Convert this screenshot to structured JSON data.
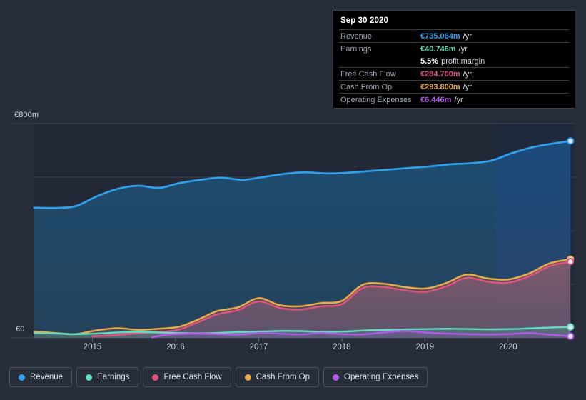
{
  "chart_data": {
    "type": "area",
    "title": "",
    "xlabel": "",
    "ylabel": "",
    "currency": "EUR",
    "y_axis": {
      "ticks": [
        "€800m",
        "€0"
      ],
      "max_label": "€800m",
      "min_label": "€0",
      "ylim": [
        0,
        800
      ],
      "gridlines": [
        0,
        200,
        400,
        600,
        800
      ],
      "grid": true
    },
    "x_axis": {
      "tick_labels": [
        "2015",
        "2016",
        "2017",
        "2018",
        "2019",
        "2020"
      ],
      "tick_values": [
        2015,
        2016,
        2017,
        2018,
        2019,
        2020
      ]
    },
    "legend_position": "bottom",
    "highlight_band_start": "2019.8",
    "series": [
      {
        "name": "Revenue",
        "color": "#2e9fe8",
        "values": [
          [
            2014.3,
            486
          ],
          [
            2014.55,
            485
          ],
          [
            2014.8,
            492
          ],
          [
            2015.05,
            528
          ],
          [
            2015.3,
            556
          ],
          [
            2015.55,
            568
          ],
          [
            2015.8,
            560
          ],
          [
            2016.05,
            578
          ],
          [
            2016.3,
            590
          ],
          [
            2016.55,
            598
          ],
          [
            2016.8,
            590
          ],
          [
            2017.05,
            600
          ],
          [
            2017.3,
            612
          ],
          [
            2017.55,
            618
          ],
          [
            2017.8,
            614
          ],
          [
            2018.05,
            616
          ],
          [
            2018.3,
            622
          ],
          [
            2018.55,
            628
          ],
          [
            2018.8,
            634
          ],
          [
            2019.05,
            640
          ],
          [
            2019.3,
            648
          ],
          [
            2019.55,
            652
          ],
          [
            2019.8,
            662
          ],
          [
            2020.05,
            690
          ],
          [
            2020.3,
            712
          ],
          [
            2020.55,
            726
          ],
          [
            2020.75,
            735.064
          ]
        ]
      },
      {
        "name": "Earnings",
        "color": "#63dbc0",
        "values": [
          [
            2014.3,
            18
          ],
          [
            2014.55,
            16
          ],
          [
            2014.8,
            14
          ],
          [
            2015.05,
            16
          ],
          [
            2015.3,
            20
          ],
          [
            2015.55,
            22
          ],
          [
            2015.8,
            20
          ],
          [
            2016.05,
            18
          ],
          [
            2016.3,
            17
          ],
          [
            2016.55,
            19
          ],
          [
            2016.8,
            22
          ],
          [
            2017.05,
            24
          ],
          [
            2017.3,
            26
          ],
          [
            2017.55,
            25
          ],
          [
            2017.8,
            22
          ],
          [
            2018.05,
            24
          ],
          [
            2018.3,
            28
          ],
          [
            2018.55,
            30
          ],
          [
            2018.8,
            32
          ],
          [
            2019.05,
            33
          ],
          [
            2019.3,
            34
          ],
          [
            2019.55,
            33
          ],
          [
            2019.8,
            32
          ],
          [
            2020.05,
            33
          ],
          [
            2020.3,
            36
          ],
          [
            2020.55,
            39
          ],
          [
            2020.75,
            40.746
          ]
        ]
      },
      {
        "name": "Free Cash Flow",
        "color": "#e0517e",
        "values": [
          [
            2015.0,
            6
          ],
          [
            2015.25,
            10
          ],
          [
            2015.5,
            16
          ],
          [
            2015.75,
            22
          ],
          [
            2016.0,
            28
          ],
          [
            2016.25,
            56
          ],
          [
            2016.5,
            88
          ],
          [
            2016.75,
            104
          ],
          [
            2017.0,
            136
          ],
          [
            2017.25,
            112
          ],
          [
            2017.5,
            106
          ],
          [
            2017.75,
            118
          ],
          [
            2018.0,
            126
          ],
          [
            2018.25,
            186
          ],
          [
            2018.5,
            190
          ],
          [
            2018.75,
            178
          ],
          [
            2019.0,
            172
          ],
          [
            2019.25,
            192
          ],
          [
            2019.5,
            224
          ],
          [
            2019.75,
            210
          ],
          [
            2020.0,
            206
          ],
          [
            2020.25,
            230
          ],
          [
            2020.5,
            268
          ],
          [
            2020.75,
            284.7
          ]
        ]
      },
      {
        "name": "Cash From Op",
        "color": "#eaa94b",
        "values": [
          [
            2014.3,
            24
          ],
          [
            2014.55,
            18
          ],
          [
            2014.8,
            14
          ],
          [
            2015.05,
            28
          ],
          [
            2015.3,
            36
          ],
          [
            2015.55,
            30
          ],
          [
            2015.8,
            34
          ],
          [
            2016.05,
            42
          ],
          [
            2016.3,
            72
          ],
          [
            2016.5,
            100
          ],
          [
            2016.75,
            114
          ],
          [
            2017.0,
            148
          ],
          [
            2017.25,
            122
          ],
          [
            2017.5,
            118
          ],
          [
            2017.75,
            130
          ],
          [
            2018.0,
            138
          ],
          [
            2018.25,
            198
          ],
          [
            2018.5,
            202
          ],
          [
            2018.75,
            190
          ],
          [
            2019.0,
            184
          ],
          [
            2019.25,
            204
          ],
          [
            2019.5,
            236
          ],
          [
            2019.75,
            222
          ],
          [
            2020.0,
            218
          ],
          [
            2020.25,
            240
          ],
          [
            2020.5,
            278
          ],
          [
            2020.75,
            293.8
          ]
        ]
      },
      {
        "name": "Operating Expenses",
        "color": "#b45ae8",
        "values": [
          [
            2015.72,
            2
          ],
          [
            2015.85,
            10
          ],
          [
            2016.0,
            14
          ],
          [
            2016.25,
            16
          ],
          [
            2016.5,
            14
          ],
          [
            2016.75,
            12
          ],
          [
            2017.0,
            18
          ],
          [
            2017.25,
            16
          ],
          [
            2017.5,
            13
          ],
          [
            2017.75,
            18
          ],
          [
            2018.0,
            14
          ],
          [
            2018.25,
            13
          ],
          [
            2018.5,
            20
          ],
          [
            2018.75,
            26
          ],
          [
            2019.0,
            20
          ],
          [
            2019.25,
            16
          ],
          [
            2019.5,
            14
          ],
          [
            2019.75,
            13
          ],
          [
            2020.0,
            14
          ],
          [
            2020.25,
            18
          ],
          [
            2020.5,
            12
          ],
          [
            2020.75,
            6.446
          ]
        ]
      }
    ],
    "endpoints": [
      {
        "series": "Revenue",
        "value": 735.064
      },
      {
        "series": "Cash From Op",
        "value": 293.8
      },
      {
        "series": "Free Cash Flow",
        "value": 284.7
      },
      {
        "series": "Earnings",
        "value": 40.746
      },
      {
        "series": "Operating Expenses",
        "value": 6.446
      }
    ]
  },
  "tooltip": {
    "date": "Sep 30 2020",
    "rows": [
      {
        "label": "Revenue",
        "value": "€735.064m",
        "unit": "/yr",
        "color": "#2e9fe8"
      },
      {
        "label": "Earnings",
        "value": "€40.746m",
        "unit": "/yr",
        "color": "#63dbc0"
      },
      {
        "label": "",
        "value": "5.5%",
        "unit": "profit margin",
        "color": "#ffffff"
      },
      {
        "label": "Free Cash Flow",
        "value": "€284.700m",
        "unit": "/yr",
        "color": "#e0517e"
      },
      {
        "label": "Cash From Op",
        "value": "€293.800m",
        "unit": "/yr",
        "color": "#eaa94b"
      },
      {
        "label": "Operating Expenses",
        "value": "€6.446m",
        "unit": "/yr",
        "color": "#b45ae8"
      }
    ]
  },
  "legend": {
    "items": [
      {
        "label": "Revenue",
        "color": "#2e9fe8"
      },
      {
        "label": "Earnings",
        "color": "#63dbc0"
      },
      {
        "label": "Free Cash Flow",
        "color": "#e0517e"
      },
      {
        "label": "Cash From Op",
        "color": "#eaa94b"
      },
      {
        "label": "Operating Expenses",
        "color": "#b45ae8"
      }
    ]
  },
  "theme": {
    "background": "#272d39",
    "plot_background": "#222836",
    "plot_background_highlight": "#1c2636",
    "gridline": "#3c4352",
    "tooltip_background": "#000000"
  }
}
